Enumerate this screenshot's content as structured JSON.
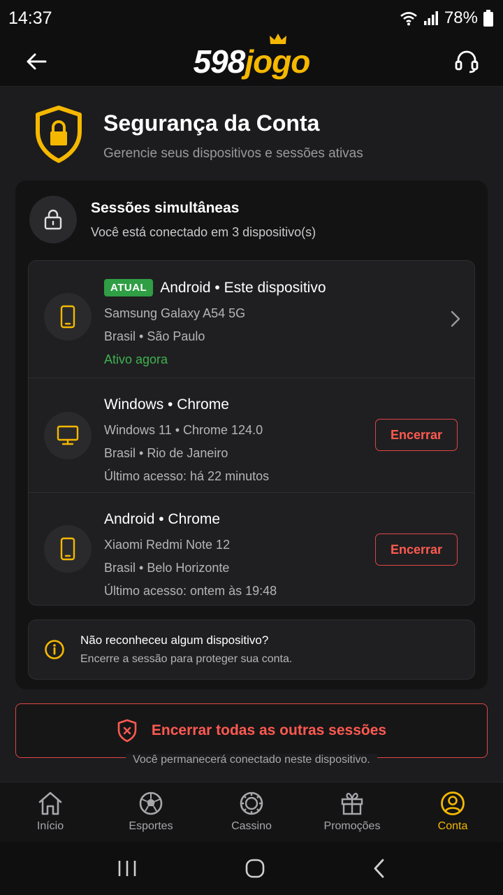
{
  "status_bar": {
    "time": "14:37",
    "battery": "78%"
  },
  "header": {
    "logo_number": "598",
    "logo_word": "jogo"
  },
  "page": {
    "title": "Segurança da Conta",
    "subtitle": "Gerencie seus dispositivos e sessões ativas"
  },
  "card": {
    "title": "Sessões simultâneas",
    "subtitle": "Você está conectado em 3 dispositivo(s)"
  },
  "sessions": [
    {
      "badge": "ATUAL",
      "title": "Android • Este dispositivo",
      "line1": "Samsung Galaxy A54 5G",
      "line2": "Brasil • São Paulo",
      "status": "Ativo agora"
    },
    {
      "title": "Windows • Chrome",
      "line1": "Windows 11 • Chrome 124.0",
      "line2": "Brasil • Rio de Janeiro",
      "line3": "Último acesso: há 22 minutos",
      "button": "Encerrar"
    },
    {
      "title": "Android • Chrome",
      "line1": "Xiaomi Redmi Note 12",
      "line2": "Brasil • Belo Horizonte",
      "line3": "Último acesso: ontem às 19:48",
      "button": "Encerrar"
    }
  ],
  "notice": {
    "title": "Não reconheceu algum dispositivo?",
    "subtitle": "Encerre a sessão para proteger sua conta."
  },
  "end_all": {
    "label": "Encerrar todas as outras sessões",
    "note": "Você permanecerá conectado neste dispositivo."
  },
  "nav": [
    {
      "label": "Início"
    },
    {
      "label": "Esportes"
    },
    {
      "label": "Cassino"
    },
    {
      "label": "Promoções"
    },
    {
      "label": "Conta"
    }
  ],
  "colors": {
    "accent": "#f5b800",
    "danger": "#e04545",
    "success": "#3fb24f",
    "background": "#1c1c1e"
  }
}
